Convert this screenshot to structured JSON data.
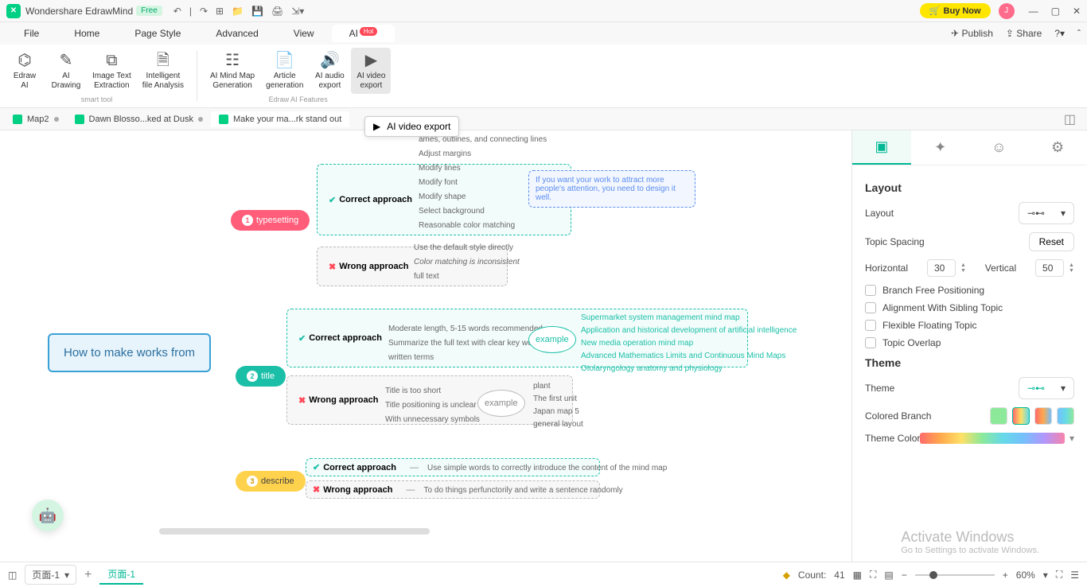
{
  "app": {
    "title": "Wondershare EdrawMind",
    "badge": "Free",
    "buy": "Buy Now",
    "avatar": "J"
  },
  "menus": {
    "file": "File",
    "home": "Home",
    "page": "Page Style",
    "advanced": "Advanced",
    "view": "View",
    "ai": "AI",
    "hot": "Hot",
    "publish": "Publish",
    "share": "Share"
  },
  "ribbon": {
    "smart": {
      "label": "smart tool",
      "b1": "Edraw\nAI",
      "b2": "AI\nDrawing",
      "b3": "Image Text\nExtraction",
      "b4": "Intelligent\nfile Analysis"
    },
    "features": {
      "label": "Edraw AI Features",
      "b1": "AI Mind Map\nGeneration",
      "b2": "Article\ngeneration",
      "b3": "AI audio\nexport",
      "b4": "AI video\nexport"
    }
  },
  "tabs": {
    "t1": "Map2",
    "t2": "Dawn Blosso...ked at Dusk",
    "t3": "Make your ma...rk stand out"
  },
  "tooltip": "AI video export",
  "mindmap": {
    "root": "How to make works from",
    "n1": "typesetting",
    "n2": "title",
    "n3": "describe",
    "correct": "Correct approach",
    "wrong": "Wrong approach",
    "t1c": [
      "ames, outlines, and connecting lines",
      "Adjust margins",
      "Modify lines",
      "Modify font",
      "Modify shape",
      "Select background",
      "Reasonable color matching"
    ],
    "t1w": [
      "Use the default style directly",
      "Color matching is inconsistent",
      "full text"
    ],
    "note": "If you want your work to attract more people's attention, you need to design it well.",
    "t2c": [
      "Moderate length, 5-15 words recommended",
      "Summarize the full text with clear key words",
      "written terms"
    ],
    "example": "example",
    "t2ex": [
      "Supermarket system management mind map",
      "Application and historical development of artificial intelligence",
      "New media operation mind map",
      "Advanced Mathematics Limits and Continuous Mind Maps",
      "Otolaryngology anatomy and physiology"
    ],
    "t2w": [
      "Title is too short",
      "Title positioning is unclear",
      "With unnecessary symbols"
    ],
    "t2wex": [
      "plant",
      "The first unit",
      "Japan map 5",
      "general layout"
    ],
    "t3c": "Use simple words to correctly introduce the content of the mind map",
    "t3w": "To do things perfunctorily and write a sentence randomly"
  },
  "panel": {
    "tab_layout": "Layout",
    "layout_label": "Layout",
    "spacing": "Topic Spacing",
    "reset": "Reset",
    "horizontal": "Horizontal",
    "h_val": "30",
    "vertical": "Vertical",
    "v_val": "50",
    "cb1": "Branch Free Positioning",
    "cb2": "Alignment With Sibling Topic",
    "cb3": "Flexible Floating Topic",
    "cb4": "Topic Overlap",
    "theme_title": "Theme",
    "theme_label": "Theme",
    "colored_branch": "Colored Branch",
    "theme_color": "Theme Color"
  },
  "bottom": {
    "page_dd": "页面-1",
    "page_active": "页面-1",
    "count_label": "Count:",
    "count_val": "41",
    "zoom": "60%"
  },
  "watermark": {
    "l1": "Activate Windows",
    "l2": "Go to Settings to activate Windows."
  }
}
